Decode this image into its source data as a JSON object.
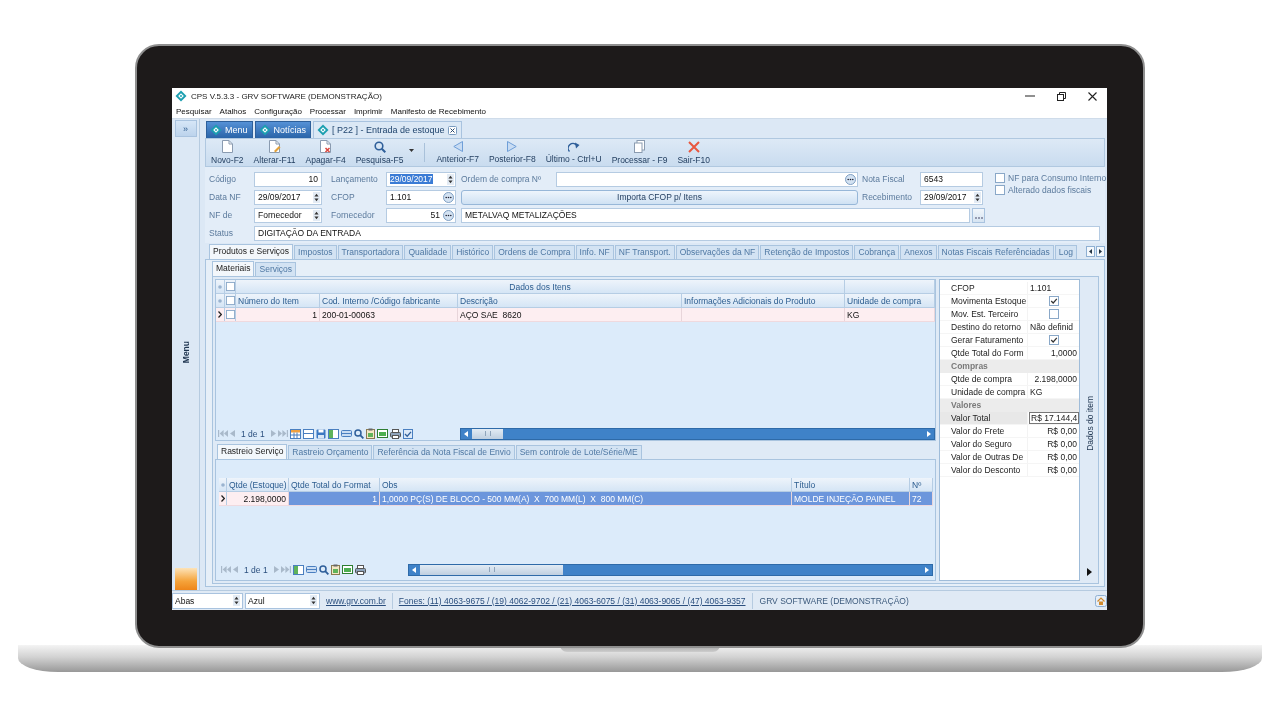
{
  "window": {
    "title": "CPS V.5.3.3 - GRV SOFTWARE (DEMONSTRAÇÃO)"
  },
  "menu": [
    "Pesquisar",
    "Atalhos",
    "Configuração",
    "Processar",
    "Imprimir",
    "Manifesto de Recebimento"
  ],
  "side_panel": {
    "toggle": "»",
    "label": "Menu"
  },
  "doc_tabs": [
    {
      "label": "Menu",
      "selected": false,
      "closable": false
    },
    {
      "label": "Notícias",
      "selected": false,
      "closable": false
    },
    {
      "label": "[ P22 ] - Entrada de estoque",
      "selected": true,
      "closable": true
    }
  ],
  "toolbar": {
    "groups": [
      [
        {
          "label": "Novo-F2",
          "kind": "new",
          "dropdown": false
        },
        {
          "label": "Alterar-F11",
          "kind": "edit",
          "dropdown": false
        },
        {
          "label": "Apagar-F4",
          "kind": "delete",
          "dropdown": false
        },
        {
          "label": "Pesquisa-F5",
          "kind": "search",
          "dropdown": true
        }
      ],
      [
        {
          "label": "Anterior-F7",
          "kind": "prev",
          "dropdown": false
        },
        {
          "label": "Posterior-F8",
          "kind": "next",
          "dropdown": false
        },
        {
          "label": "Último - Ctrl+U",
          "kind": "last",
          "dropdown": false
        },
        {
          "label": "Processar - F9",
          "kind": "process",
          "dropdown": false
        },
        {
          "label": "Sair-F10",
          "kind": "exit",
          "dropdown": false
        }
      ]
    ]
  },
  "form": {
    "code": {
      "label": "Código",
      "value": "10"
    },
    "entry_date": {
      "label": "Lançamento",
      "value": "29/09/2017",
      "focused": true
    },
    "purchase_order": {
      "label": "Ordem de compra Nº"
    },
    "invoice_number": {
      "label": "Nota Fiscal",
      "value": "6543"
    },
    "nf_date": {
      "label": "Data NF",
      "value": "29/09/2017",
      "focused": false
    },
    "cfop": {
      "label": "CFOP",
      "value": "1.101"
    },
    "import_button": "Importa CFOP p/ Itens",
    "receipt_date": {
      "label": "Recebimento",
      "value": "29/09/2017",
      "focused": false
    },
    "nf_from": {
      "label": "NF de",
      "value": "Fornecedor"
    },
    "supplier": {
      "label": "Fornecedor",
      "code": "51",
      "name": "METALVAQ METALIZAÇÕES"
    },
    "status": {
      "label": "Status",
      "value": "DIGITAÇÃO DA ENTRADA"
    },
    "checkboxes": [
      {
        "label": "NF para Consumo Interno",
        "checked": false
      },
      {
        "label": "Alterado dados fiscais",
        "checked": false
      }
    ]
  },
  "tabs": [
    {
      "label": "Produtos e Serviços",
      "selected": true
    },
    {
      "label": "Impostos",
      "selected": false
    },
    {
      "label": "Transportadora",
      "selected": false
    },
    {
      "label": "Qualidade",
      "selected": false
    },
    {
      "label": "Histórico",
      "selected": false
    },
    {
      "label": "Ordens de Compra",
      "selected": false
    },
    {
      "label": "Info. NF",
      "selected": false
    },
    {
      "label": "NF Transport.",
      "selected": false
    },
    {
      "label": "Observações da NF",
      "selected": false
    },
    {
      "label": "Retenção de Impostos",
      "selected": false
    },
    {
      "label": "Cobrança",
      "selected": false
    },
    {
      "label": "Anexos",
      "selected": false
    },
    {
      "label": "Notas Fiscais Referênciadas",
      "selected": false
    },
    {
      "label": "Log",
      "selected": false
    }
  ],
  "sub_tabs": [
    {
      "label": "Materiais",
      "selected": true
    },
    {
      "label": "Serviços",
      "selected": false
    }
  ],
  "items_grid": {
    "group_header": "Dados dos Itens",
    "group_checked": false,
    "header_checked": false,
    "columns": [
      "Número do Item",
      "Cod. Interno /Código fabricante",
      "Descrição",
      "Informações Adicionais do Produto",
      "Unidade de compra"
    ],
    "rows": [
      {
        "cells": [
          "1",
          "200-01-00063",
          "AÇO SAE  8620",
          null,
          "KG"
        ],
        "checked": false,
        "current": true,
        "selected": false
      }
    ],
    "pager": "1 de 1"
  },
  "lower_tabs": [
    {
      "label": "Rastreio Serviço",
      "selected": true
    },
    {
      "label": "Rastreio Orçamento",
      "selected": false
    },
    {
      "label": "Referência da Nota Fiscal de Envio",
      "selected": false
    },
    {
      "label": "Sem controle de Lote/Série/ME",
      "selected": false
    }
  ],
  "lower_grid": {
    "columns": [
      "Qtde (Estoque)",
      "Qtde Total do Format",
      "Obs",
      "Título",
      "Nº"
    ],
    "rows": [
      {
        "cells": [
          "2.198,0000",
          "1",
          "1,0000 PÇ(S) DE BLOCO - 500 MM(A)  X  700 MM(L)  X  800 MM(C)",
          "MOLDE INJEÇÃO PAINEL",
          "72"
        ],
        "current": true,
        "selected": true
      }
    ],
    "pager": "1 de 1"
  },
  "properties": {
    "side_label": "Dados do item",
    "rows": [
      {
        "kind": "text",
        "label": "CFOP",
        "value": "1.101",
        "selected": false
      },
      {
        "kind": "check",
        "label": "Movimenta Estoque",
        "checked": true,
        "selected": false
      },
      {
        "kind": "check",
        "label": "Mov. Est. Terceiro",
        "checked": false,
        "selected": false
      },
      {
        "kind": "text",
        "label": "Destino do retorno",
        "value": "Não definid",
        "selected": false
      },
      {
        "kind": "check",
        "label": "Gerar Faturamento",
        "checked": true,
        "selected": false
      },
      {
        "kind": "number",
        "label": "Qtde Total do Form",
        "value": "1,0000",
        "selected": false
      },
      {
        "kind": "category",
        "label": "Compras"
      },
      {
        "kind": "number",
        "label": "Qtde de compra",
        "value": "2.198,0000",
        "selected": false
      },
      {
        "kind": "text",
        "label": "Unidade de compra",
        "value": "KG",
        "selected": false
      },
      {
        "kind": "category",
        "label": "Valores"
      },
      {
        "kind": "number",
        "label": "Valor Total",
        "value": "R$ 17.144,4",
        "selected": true
      },
      {
        "kind": "number",
        "label": "Valor do Frete",
        "value": "R$ 0,00",
        "selected": false
      },
      {
        "kind": "number",
        "label": "Valor do Seguro",
        "value": "R$ 0,00",
        "selected": false
      },
      {
        "kind": "number",
        "label": "Valor de Outras De",
        "value": "R$ 0,00",
        "selected": false
      },
      {
        "kind": "number",
        "label": "Valor do Desconto",
        "value": "R$ 0,00",
        "selected": false
      }
    ]
  },
  "status_bar": {
    "layout": "Abas",
    "theme": "Azul",
    "website": "www.grv.com.br",
    "phones": "Fones: (11) 4063-9675 / (19) 4062-9702 / (21) 4063-6075 / (31) 4063-9065 / (47) 4063-9357",
    "company": "GRV SOFTWARE (DEMONSTRAÇÃO)"
  }
}
